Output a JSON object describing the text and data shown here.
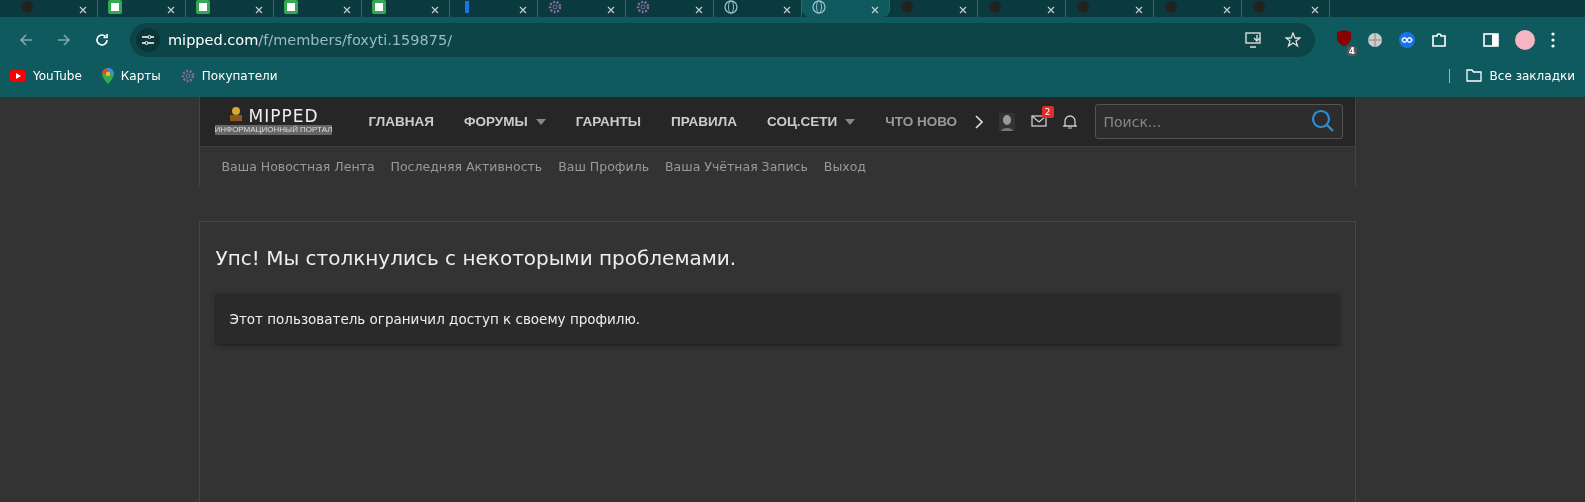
{
  "browser": {
    "tabs": [
      {
        "kind": "dark",
        "selected": false
      },
      {
        "kind": "sheet",
        "selected": false
      },
      {
        "kind": "sheet",
        "selected": false
      },
      {
        "kind": "sheet",
        "selected": false
      },
      {
        "kind": "sheet",
        "selected": false
      },
      {
        "kind": "bar",
        "selected": false
      },
      {
        "kind": "gear",
        "selected": false
      },
      {
        "kind": "gear",
        "selected": false
      },
      {
        "kind": "globe",
        "selected": false
      },
      {
        "kind": "globe",
        "selected": true
      },
      {
        "kind": "dark",
        "selected": false
      },
      {
        "kind": "dark",
        "selected": false
      },
      {
        "kind": "dark",
        "selected": false
      },
      {
        "kind": "dark",
        "selected": false
      },
      {
        "kind": "dark",
        "selected": false
      }
    ],
    "url_host": "mipped.com",
    "url_path": "/f/members/foxyti.159875/",
    "extension_badge": "4",
    "bookmarks": [
      {
        "kind": "youtube",
        "label": "YouTube"
      },
      {
        "kind": "maps",
        "label": "Карты"
      },
      {
        "kind": "gear",
        "label": "Покупатели"
      }
    ],
    "all_bookmarks": "Все закладки"
  },
  "site": {
    "logo_title": "MIPPED",
    "logo_subtitle": "ИНФОРМАЦИОННЫЙ ПОРТАЛ",
    "nav": [
      {
        "label": "ГЛАВНАЯ",
        "dropdown": false
      },
      {
        "label": "ФОРУМЫ",
        "dropdown": true
      },
      {
        "label": "ГАРАНТЫ",
        "dropdown": false
      },
      {
        "label": "ПРАВИЛА",
        "dropdown": false
      },
      {
        "label": "СОЦ.СЕТИ",
        "dropdown": true
      },
      {
        "label": "ЧТО НОВО",
        "dropdown": false
      }
    ],
    "messages_badge": "2",
    "search": {
      "placeholder": "Поиск..."
    },
    "subnav": [
      "Ваша Новостная Лента",
      "Последняя Активность",
      "Ваш Профиль",
      "Ваша Учётная Запись",
      "Выход"
    ],
    "error_title": "Упс! Мы столкнулись с некоторыми проблемами.",
    "error_message": "Этот пользователь ограничил доступ к своему профилю."
  }
}
